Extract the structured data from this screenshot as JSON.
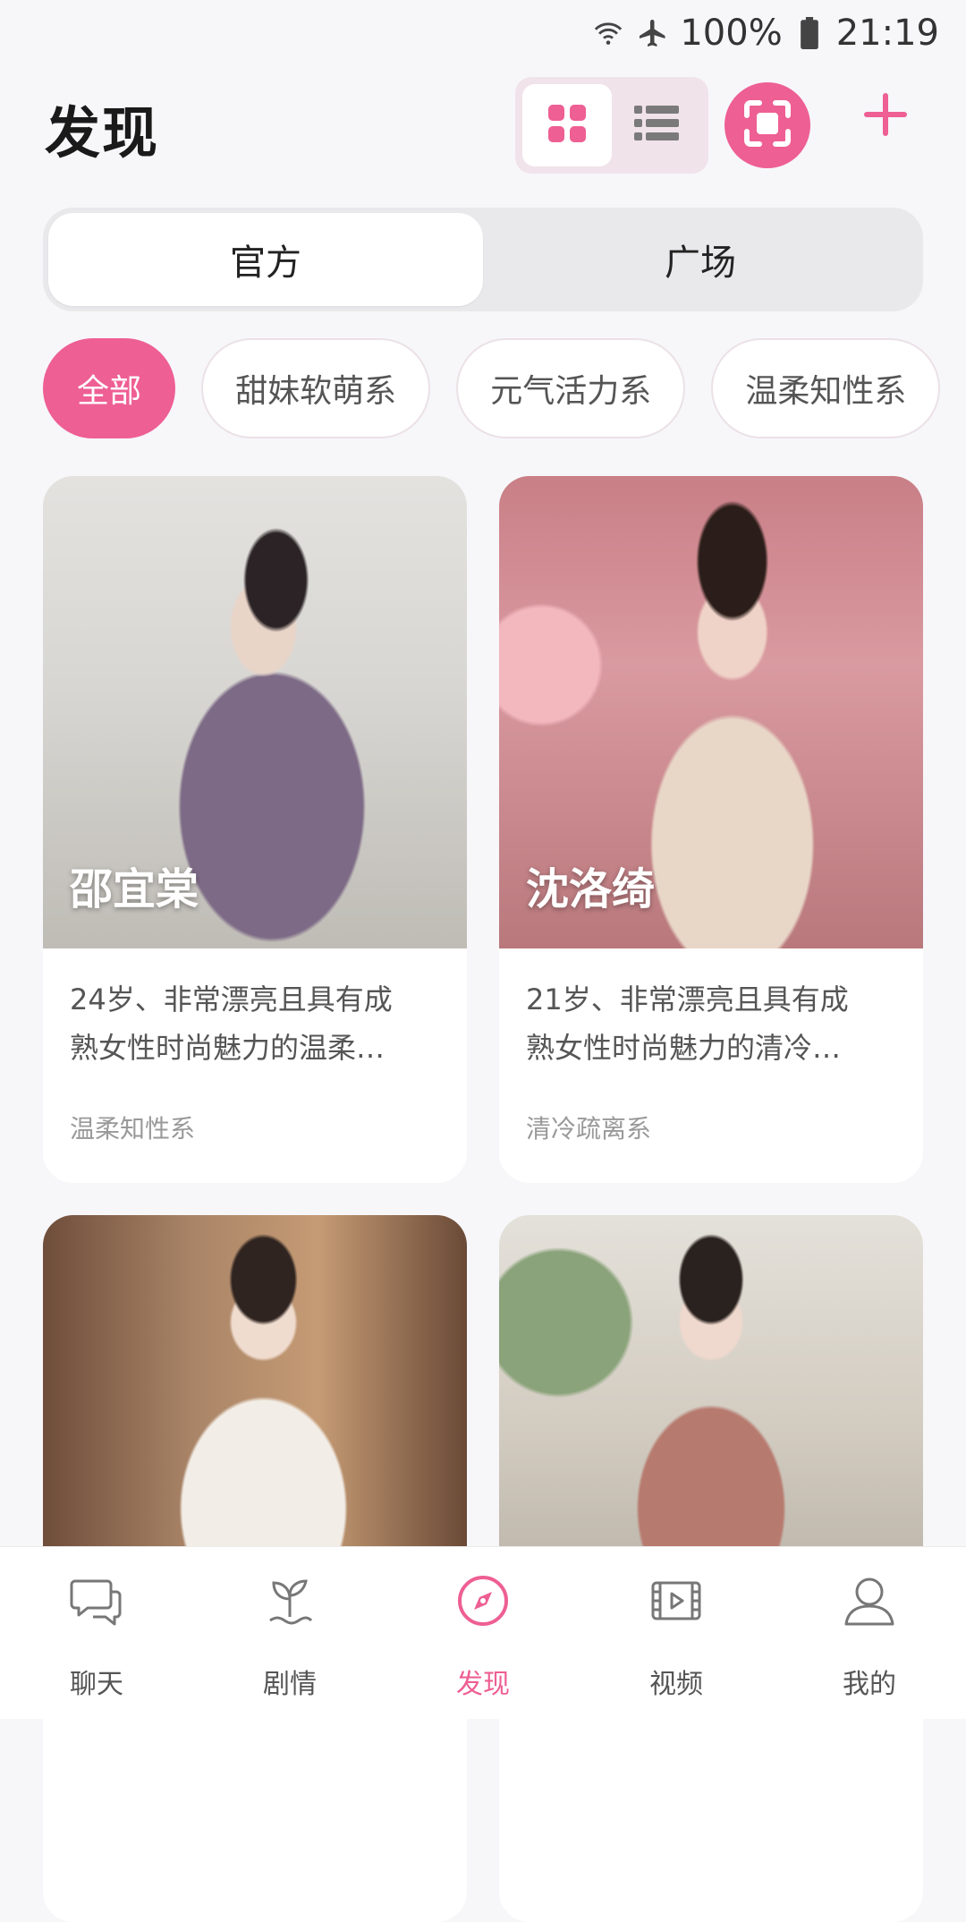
{
  "status_bar": {
    "battery": "100%",
    "time": "21:19"
  },
  "header": {
    "title": "发现",
    "accent_color": "#ee5f93"
  },
  "segment": {
    "tabs": [
      {
        "label": "官方",
        "active": true
      },
      {
        "label": "广场",
        "active": false
      }
    ]
  },
  "chips": [
    {
      "label": "全部",
      "active": true
    },
    {
      "label": "甜妹软萌系",
      "active": false
    },
    {
      "label": "元气活力系",
      "active": false
    },
    {
      "label": "温柔知性系",
      "active": false
    }
  ],
  "cards": [
    {
      "name": "邵宜棠",
      "desc_line1": "24岁、非常漂亮且具有成",
      "desc_line2": "熟女性时尚魅力的温柔…",
      "tag": "温柔知性系"
    },
    {
      "name": "沈洛绮",
      "desc_line1": "21岁、非常漂亮且具有成",
      "desc_line2": "熟女性时尚魅力的清冷…",
      "tag": "清冷疏离系"
    },
    {
      "name": "",
      "desc_line1": "",
      "desc_line2": "",
      "tag": ""
    },
    {
      "name": "",
      "desc_line1": "",
      "desc_line2": "",
      "tag": ""
    }
  ],
  "bottom_nav": [
    {
      "label": "聊天",
      "icon": "chat-icon",
      "active": false
    },
    {
      "label": "剧情",
      "icon": "sprout-icon",
      "active": false
    },
    {
      "label": "发现",
      "icon": "compass-icon",
      "active": true
    },
    {
      "label": "视频",
      "icon": "video-icon",
      "active": false
    },
    {
      "label": "我的",
      "icon": "user-icon",
      "active": false
    }
  ]
}
